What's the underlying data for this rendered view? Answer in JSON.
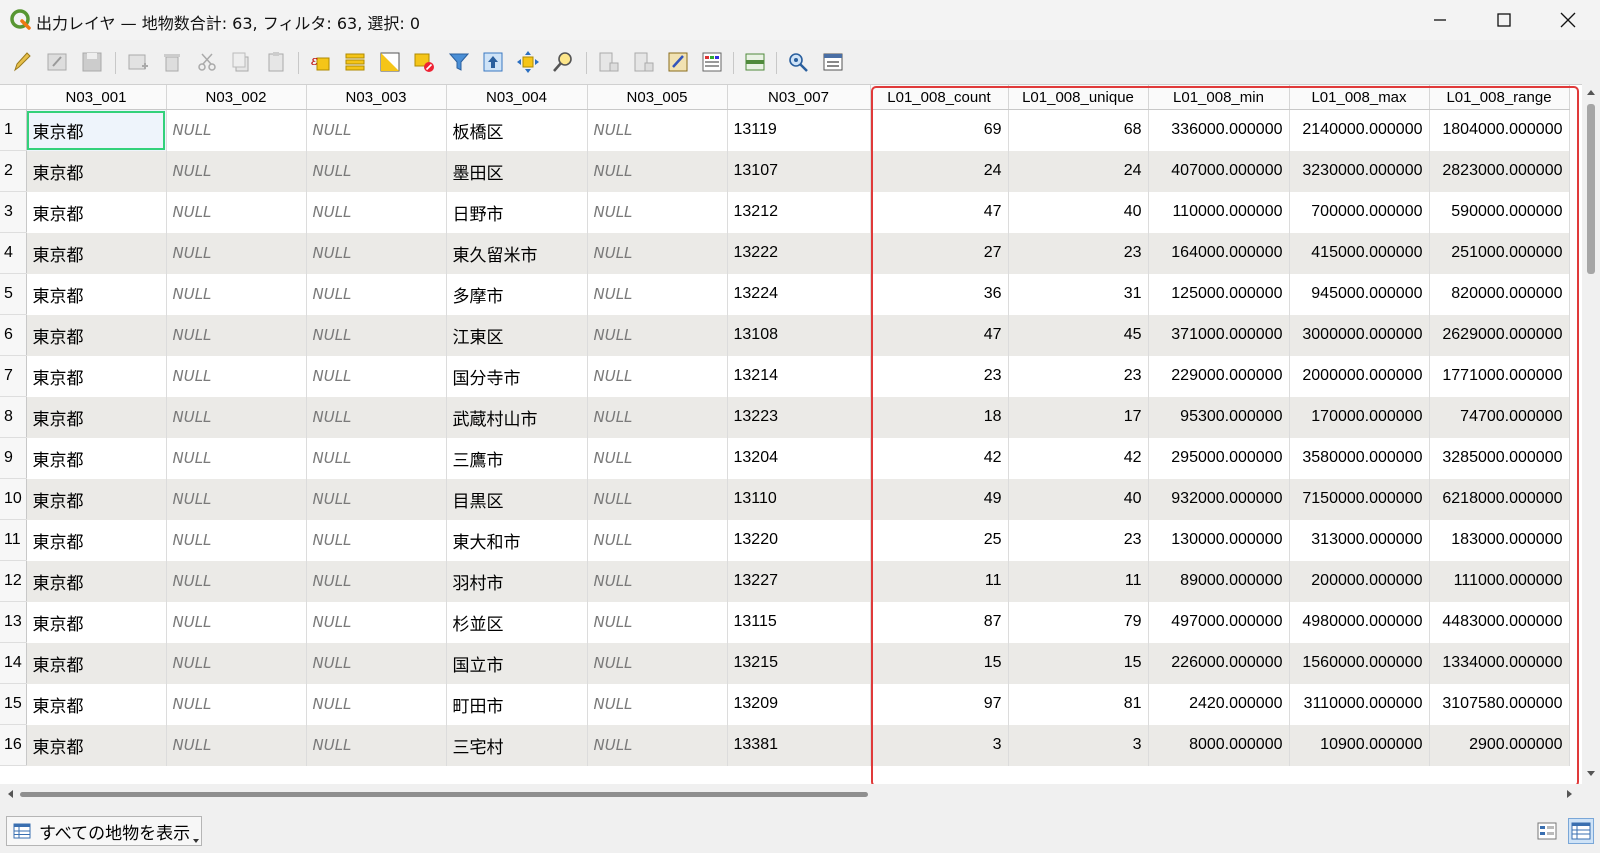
{
  "window": {
    "title": "出力レイヤ — 地物数合計: 63, フィルタ: 63, 選択: 0"
  },
  "toolbar": {
    "icons": [
      "pencil-icon",
      "edit-table-icon",
      "save-icon",
      "add-feature-icon",
      "delete-icon",
      "cut-icon",
      "copy-icon",
      "paste-icon",
      "expression-select-icon",
      "select-all-icon",
      "invert-selection-icon",
      "deselect-icon",
      "filter-icon",
      "move-top-icon",
      "pan-icon",
      "zoom-icon",
      "new-field-icon",
      "delete-field-icon",
      "field-calculator-icon",
      "conditional-format-icon",
      "dock-icon",
      "actions-icon",
      "form-view-icon"
    ]
  },
  "table": {
    "columns": [
      "N03_001",
      "N03_002",
      "N03_003",
      "N03_004",
      "N03_005",
      "N03_007",
      "L01_008_count",
      "L01_008_unique",
      "L01_008_min",
      "L01_008_max",
      "L01_008_range"
    ],
    "rows": [
      [
        "1",
        "東京都",
        "NULL",
        "NULL",
        "板橋区",
        "NULL",
        "13119",
        "69",
        "68",
        "336000.000000",
        "2140000.000000",
        "1804000.000000"
      ],
      [
        "2",
        "東京都",
        "NULL",
        "NULL",
        "墨田区",
        "NULL",
        "13107",
        "24",
        "24",
        "407000.000000",
        "3230000.000000",
        "2823000.000000"
      ],
      [
        "3",
        "東京都",
        "NULL",
        "NULL",
        "日野市",
        "NULL",
        "13212",
        "47",
        "40",
        "110000.000000",
        "700000.000000",
        "590000.000000"
      ],
      [
        "4",
        "東京都",
        "NULL",
        "NULL",
        "東久留米市",
        "NULL",
        "13222",
        "27",
        "23",
        "164000.000000",
        "415000.000000",
        "251000.000000"
      ],
      [
        "5",
        "東京都",
        "NULL",
        "NULL",
        "多摩市",
        "NULL",
        "13224",
        "36",
        "31",
        "125000.000000",
        "945000.000000",
        "820000.000000"
      ],
      [
        "6",
        "東京都",
        "NULL",
        "NULL",
        "江東区",
        "NULL",
        "13108",
        "47",
        "45",
        "371000.000000",
        "3000000.000000",
        "2629000.000000"
      ],
      [
        "7",
        "東京都",
        "NULL",
        "NULL",
        "国分寺市",
        "NULL",
        "13214",
        "23",
        "23",
        "229000.000000",
        "2000000.000000",
        "1771000.000000"
      ],
      [
        "8",
        "東京都",
        "NULL",
        "NULL",
        "武蔵村山市",
        "NULL",
        "13223",
        "18",
        "17",
        "95300.000000",
        "170000.000000",
        "74700.000000"
      ],
      [
        "9",
        "東京都",
        "NULL",
        "NULL",
        "三鷹市",
        "NULL",
        "13204",
        "42",
        "42",
        "295000.000000",
        "3580000.000000",
        "3285000.000000"
      ],
      [
        "10",
        "東京都",
        "NULL",
        "NULL",
        "目黒区",
        "NULL",
        "13110",
        "49",
        "40",
        "932000.000000",
        "7150000.000000",
        "6218000.000000"
      ],
      [
        "11",
        "東京都",
        "NULL",
        "NULL",
        "東大和市",
        "NULL",
        "13220",
        "25",
        "23",
        "130000.000000",
        "313000.000000",
        "183000.000000"
      ],
      [
        "12",
        "東京都",
        "NULL",
        "NULL",
        "羽村市",
        "NULL",
        "13227",
        "11",
        "11",
        "89000.000000",
        "200000.000000",
        "111000.000000"
      ],
      [
        "13",
        "東京都",
        "NULL",
        "NULL",
        "杉並区",
        "NULL",
        "13115",
        "87",
        "79",
        "497000.000000",
        "4980000.000000",
        "4483000.000000"
      ],
      [
        "14",
        "東京都",
        "NULL",
        "NULL",
        "国立市",
        "NULL",
        "13215",
        "15",
        "15",
        "226000.000000",
        "1560000.000000",
        "1334000.000000"
      ],
      [
        "15",
        "東京都",
        "NULL",
        "NULL",
        "町田市",
        "NULL",
        "13209",
        "97",
        "81",
        "2420.000000",
        "3110000.000000",
        "3107580.000000"
      ],
      [
        "16",
        "東京都",
        "NULL",
        "NULL",
        "三宅村",
        "NULL",
        "13381",
        "3",
        "3",
        "8000.000000",
        "10900.000000",
        "2900.000000"
      ]
    ]
  },
  "footer": {
    "show_all_label": "すべての地物を表示"
  }
}
